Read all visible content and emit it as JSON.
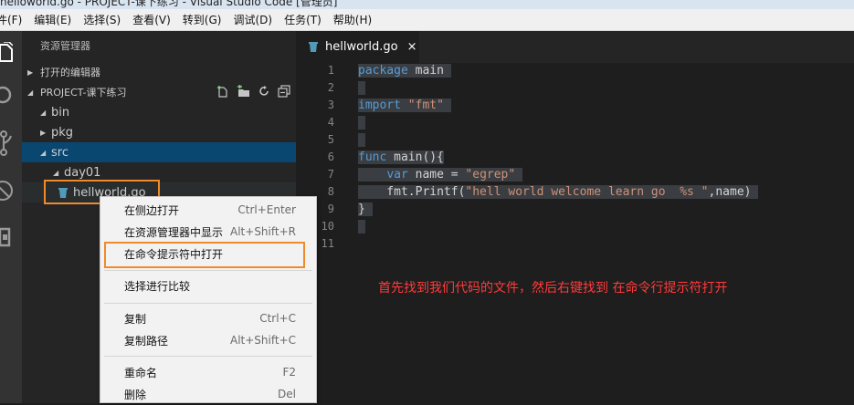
{
  "window": {
    "title": "helloworld.go - PROJECT-课下练习 - Visual Studio Code [管理员]"
  },
  "menu": [
    "件(F)",
    "编辑(E)",
    "选择(S)",
    "查看(V)",
    "转到(G)",
    "调试(D)",
    "任务(T)",
    "帮助(H)"
  ],
  "sidebar": {
    "title": "资源管理器",
    "open_editors": "打开的编辑器",
    "project": "PROJECT-课下练习",
    "tree": [
      {
        "label": "bin",
        "twisty": "◢"
      },
      {
        "label": "pkg",
        "twisty": "▶"
      },
      {
        "label": "src",
        "twisty": "◢"
      },
      {
        "label": "day01",
        "twisty": "◢"
      },
      {
        "label": "hellworld.go",
        "twisty": ""
      }
    ]
  },
  "editor": {
    "tab": {
      "label": "hellworld.go",
      "close": "×"
    },
    "line_numbers": [
      "1",
      "2",
      "3",
      "4",
      "5",
      "6",
      "7",
      "8",
      "9",
      "10",
      "11"
    ]
  },
  "context_menu": [
    {
      "label": "在侧边打开",
      "shortcut": "Ctrl+Enter"
    },
    {
      "label": "在资源管理器中显示",
      "shortcut": "Alt+Shift+R"
    },
    {
      "label": "在命令提示符中打开",
      "shortcut": ""
    },
    {
      "label": "选择进行比较",
      "shortcut": ""
    },
    {
      "label": "复制",
      "shortcut": "Ctrl+C"
    },
    {
      "label": "复制路径",
      "shortcut": "Alt+Shift+C"
    },
    {
      "label": "重命名",
      "shortcut": "F2"
    },
    {
      "label": "删除",
      "shortcut": "Del"
    }
  ],
  "annotation": "首先找到我们代码的文件，然后右键找到 在命令行提示符打开",
  "colors": {
    "accent": "#f08a2b",
    "selection": "#094771",
    "note": "#ff3b3b"
  }
}
